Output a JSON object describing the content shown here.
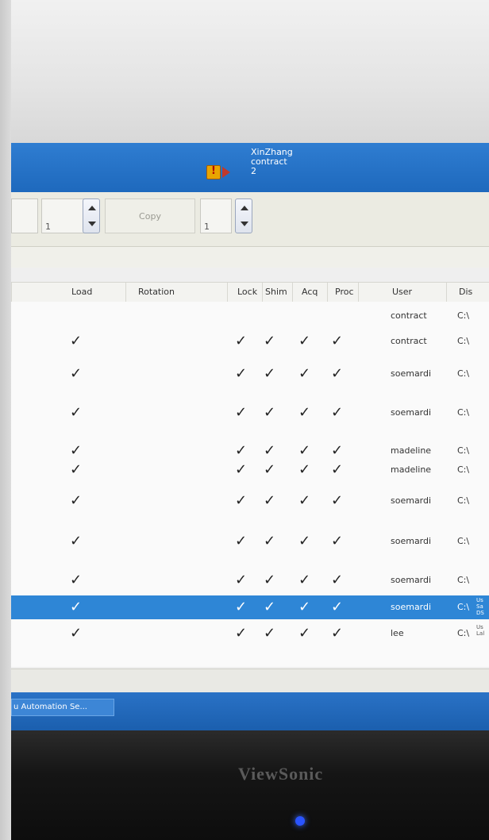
{
  "window": {
    "status_lines": [
      "XinZhang",
      "contract",
      "2"
    ]
  },
  "toolbar": {
    "field_a_value": "1",
    "copy_label": "Copy",
    "field_b_value": "1"
  },
  "table": {
    "columns": [
      "Load",
      "Rotation",
      "Lock",
      "Shim",
      "Acq",
      "Proc",
      "User",
      "Dis"
    ],
    "rows": [
      {
        "load": false,
        "lock": false,
        "shim": false,
        "acq": false,
        "proc": false,
        "user": "contract",
        "dis": "C:\\",
        "extra": "",
        "selected": false
      },
      {
        "load": true,
        "lock": true,
        "shim": true,
        "acq": true,
        "proc": true,
        "user": "contract",
        "dis": "C:\\",
        "extra": "",
        "selected": false
      },
      {
        "load": true,
        "lock": true,
        "shim": true,
        "acq": true,
        "proc": true,
        "user": "soemardi",
        "dis": "C:\\",
        "extra": "",
        "selected": false
      },
      {
        "load": true,
        "lock": true,
        "shim": true,
        "acq": true,
        "proc": true,
        "user": "soemardi",
        "dis": "C:\\",
        "extra": "",
        "selected": false
      },
      {
        "load": true,
        "lock": true,
        "shim": true,
        "acq": true,
        "proc": true,
        "user": "madeline",
        "dis": "C:\\",
        "extra": "",
        "selected": false
      },
      {
        "load": true,
        "lock": true,
        "shim": true,
        "acq": true,
        "proc": true,
        "user": "madeline",
        "dis": "C:\\",
        "extra": "",
        "selected": false
      },
      {
        "load": true,
        "lock": true,
        "shim": true,
        "acq": true,
        "proc": true,
        "user": "soemardi",
        "dis": "C:\\",
        "extra": "",
        "selected": false
      },
      {
        "load": true,
        "lock": true,
        "shim": true,
        "acq": true,
        "proc": true,
        "user": "soemardi",
        "dis": "C:\\",
        "extra": "",
        "selected": false
      },
      {
        "load": true,
        "lock": true,
        "shim": true,
        "acq": true,
        "proc": true,
        "user": "soemardi",
        "dis": "C:\\",
        "extra": "",
        "selected": false
      },
      {
        "load": true,
        "lock": true,
        "shim": true,
        "acq": true,
        "proc": true,
        "user": "soemardi",
        "dis": "C:\\",
        "extra": "Us Sa DS",
        "selected": true
      },
      {
        "load": true,
        "lock": true,
        "shim": true,
        "acq": true,
        "proc": true,
        "user": "lee",
        "dis": "C:\\",
        "extra": "Us Lal",
        "selected": false
      }
    ]
  },
  "taskbar": {
    "item_label": "u Automation Se..."
  },
  "monitor": {
    "brand": "ViewSonic"
  },
  "colors": {
    "titlebar": "#1e69bd",
    "selection": "#2e86d6",
    "power_led": "#2a54ff"
  },
  "icons": {
    "status": "warning-status-icon",
    "check": "check-icon"
  }
}
